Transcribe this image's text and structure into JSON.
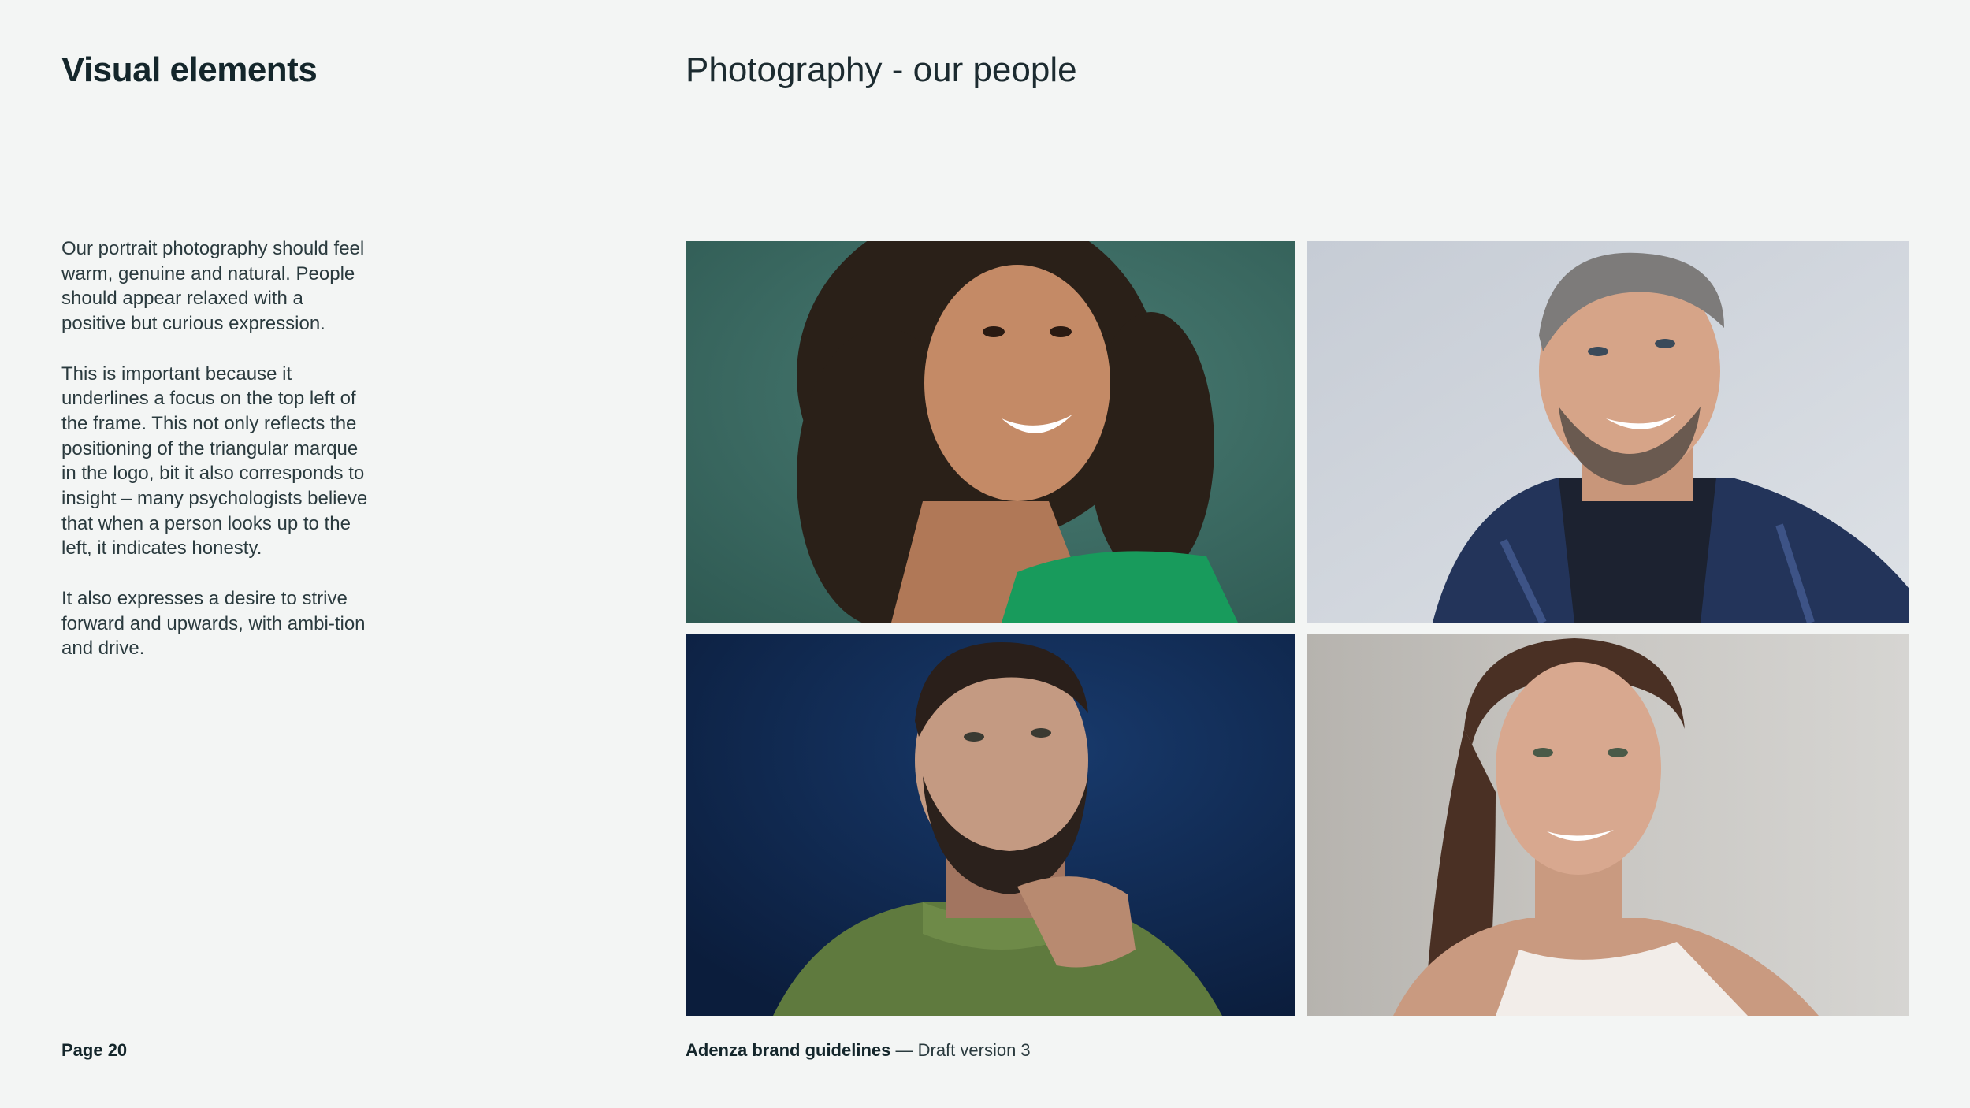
{
  "header": {
    "section_title": "Visual elements",
    "page_title": "Photography - our people"
  },
  "body": {
    "paragraphs": [
      "Our portrait photography should feel warm, genuine and natural. People should appear relaxed with a positive but curious expression.",
      "This is important because it underlines a focus on the top left of the frame. This not only reflects the positioning of the triangular marque in the logo, bit it also corresponds to insight – many psychologists believe that when a person looks up to the left, it indicates honesty.",
      "It also expresses a desire to strive forward and upwards, with ambi-tion and drive."
    ]
  },
  "photos": [
    {
      "subject": "woman-curly-hair-green-top",
      "background": "#3d6e66"
    },
    {
      "subject": "man-grey-hair-plaid-blazer",
      "background": "#c9ced6"
    },
    {
      "subject": "bearded-man-green-sweater",
      "background": "#122a52"
    },
    {
      "subject": "woman-ponytail-white-top",
      "background": "#bfbebb"
    }
  ],
  "footer": {
    "page_number": "Page 20",
    "brand": "Adenza brand guidelines",
    "separator": " — ",
    "version": "Draft version 3"
  },
  "colors": {
    "background": "#f3f5f4",
    "text_dark": "#14262b"
  }
}
